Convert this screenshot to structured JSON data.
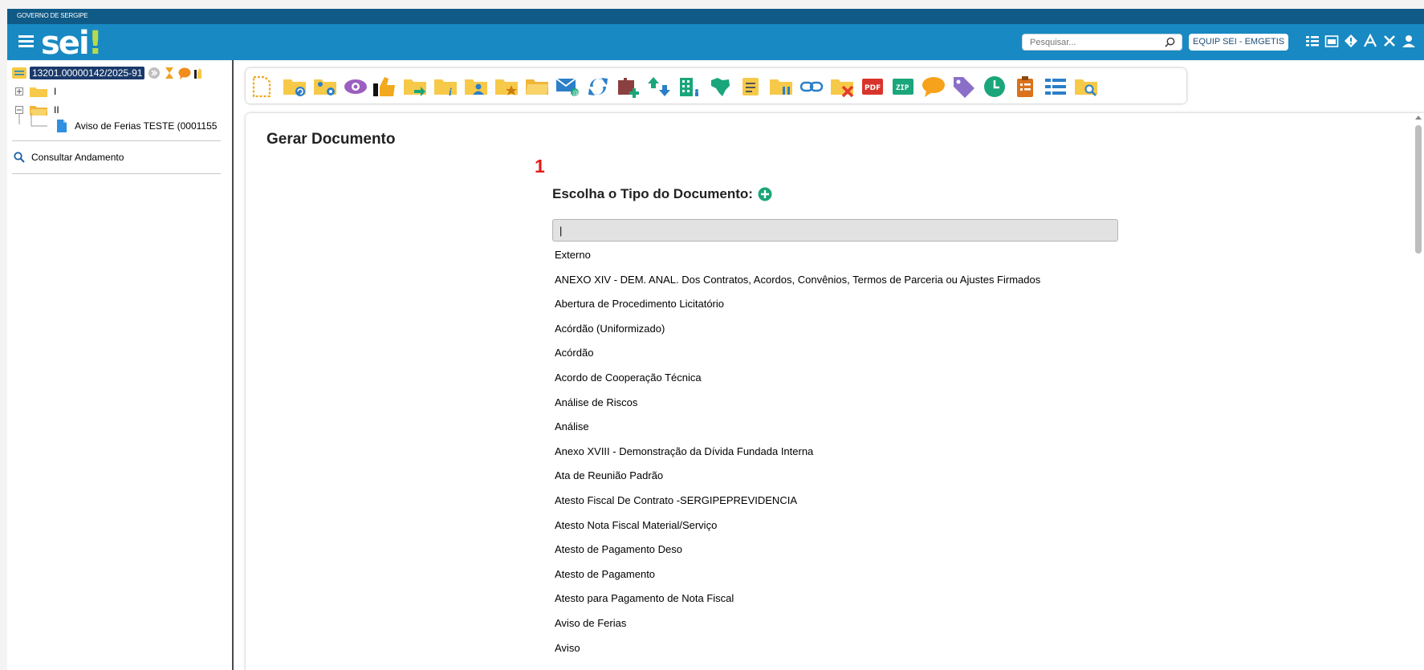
{
  "header": {
    "government": "GOVERNO DE SERGIPE",
    "logo": "sei",
    "logo_mark": "!",
    "search_placeholder": "Pesquisar...",
    "unit": "EQUIP SEI - EMGETIS",
    "icons": [
      "list-icon",
      "calendar-icon",
      "alert-icon",
      "font-size-icon",
      "tools-icon",
      "user-icon"
    ]
  },
  "tree": {
    "process_number": "13201.00000142/2025-91",
    "folders": [
      {
        "label": "I",
        "expanded": false
      },
      {
        "label": "II",
        "expanded": true
      }
    ],
    "document": "Aviso de Ferias TESTE (0001155",
    "consult": "Consultar Andamento"
  },
  "toolbar": {
    "icons": [
      "new-document-icon",
      "relate-process-icon",
      "process-settings-icon",
      "view-icon",
      "highlight-icon",
      "send-process-icon",
      "forward-icon",
      "process-info-icon",
      "assign-user-icon",
      "favorite-folder-icon",
      "open-folder-icon",
      "email-icon",
      "refresh-icon",
      "add-block-icon",
      "sort-icon",
      "building-icon",
      "map-icon",
      "notes-icon",
      "pause-icon",
      "link-icon",
      "close-process-icon",
      "pdf-icon",
      "zip-icon",
      "comment-icon",
      "tag-icon",
      "clock-icon",
      "checklist-icon",
      "list-view-icon",
      "search-folder-icon"
    ]
  },
  "main": {
    "title": "Gerar Documento",
    "marker": "1",
    "choose_label": "Escolha o Tipo do Documento:",
    "filter_value": "|",
    "document_types": [
      "Externo",
      "ANEXO XIV - DEM. ANAL. Dos Contratos, Acordos, Convênios, Termos de Parceria ou Ajustes Firmados",
      "Abertura de Procedimento Licitatório",
      "Acórdão (Uniformizado)",
      "Acórdão",
      "Acordo de Cooperação Técnica",
      "Análise de Riscos",
      "Análise",
      "Anexo XVIII - Demonstração da Dívida Fundada Interna",
      "Ata de Reunião Padrão",
      "Atesto Fiscal De Contrato -SERGIPEPREVIDENCIA",
      "Atesto Nota Fiscal Material/Serviço",
      "Atesto de Pagamento Deso",
      "Atesto de Pagamento",
      "Atesto para Pagamento de Nota Fiscal",
      "Aviso de Ferias",
      "Aviso"
    ]
  },
  "colors": {
    "header_blue": "#1889c2",
    "top_strip": "#0f5a86",
    "folder_yellow": "#f7c948",
    "accent_green": "#1aa67a",
    "marker_red": "#e41b17"
  }
}
